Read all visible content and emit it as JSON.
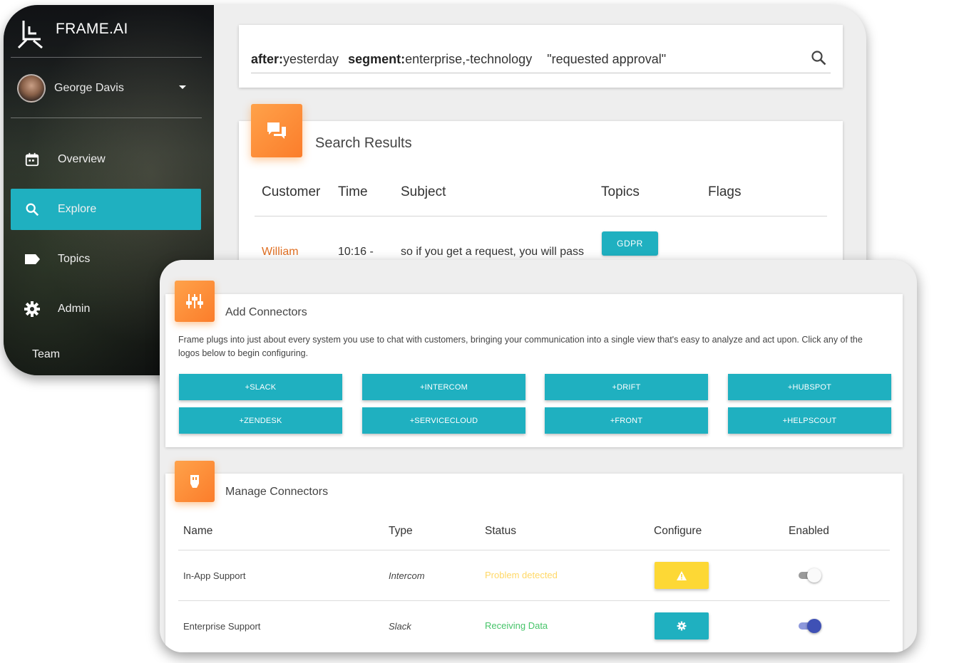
{
  "app": {
    "brand": "FRAME.AI"
  },
  "user": {
    "name": "George Davis"
  },
  "sidebar": {
    "items": [
      {
        "label": "Overview",
        "icon": "calendar-icon"
      },
      {
        "label": "Explore",
        "icon": "search-icon",
        "active": true
      },
      {
        "label": "Topics",
        "icon": "label-icon"
      },
      {
        "label": "Admin",
        "icon": "gear-icon"
      }
    ],
    "section": "Team"
  },
  "search": {
    "key1": "after:",
    "val1": "yesterday",
    "key2": "segment:",
    "val2": "enterprise,-technology",
    "phrase": "\"requested approval\""
  },
  "results": {
    "title": "Search Results",
    "columns": [
      "Customer",
      "Time",
      "Subject",
      "Topics",
      "Flags"
    ],
    "rows": [
      {
        "customer": "William",
        "time": "10:16 -",
        "subject": "so if you get a request, you will pass",
        "topic": "GDPR"
      }
    ]
  },
  "add_connectors": {
    "title": "Add Connectors",
    "description": "Frame plugs into just about every system you use to chat with customers, bringing your communication into a single view that's easy to analyze and act upon. Click any of the logos below to begin configuring.",
    "buttons": [
      "+SLACK",
      "+INTERCOM",
      "+DRIFT",
      "+HUBSPOT",
      "+ZENDESK",
      "+SERVICECLOUD",
      "+FRONT",
      "+HELPSCOUT"
    ]
  },
  "manage_connectors": {
    "title": "Manage Connectors",
    "columns": [
      "Name",
      "Type",
      "Status",
      "Configure",
      "Enabled"
    ],
    "rows": [
      {
        "name": "In-App Support",
        "type": "Intercom",
        "status": "Problem detected",
        "configure": "warning-icon",
        "enabled": false
      },
      {
        "name": "Enterprise Support",
        "type": "Slack",
        "status": "Receiving Data",
        "configure": "gear-icon",
        "enabled": true
      }
    ]
  },
  "colors": {
    "accent": "#1fb0c0",
    "badge": "#fb8c2b",
    "warning": "#fdd835",
    "ok_status": "#47c46a",
    "toggle_on": "#3f51b5"
  }
}
